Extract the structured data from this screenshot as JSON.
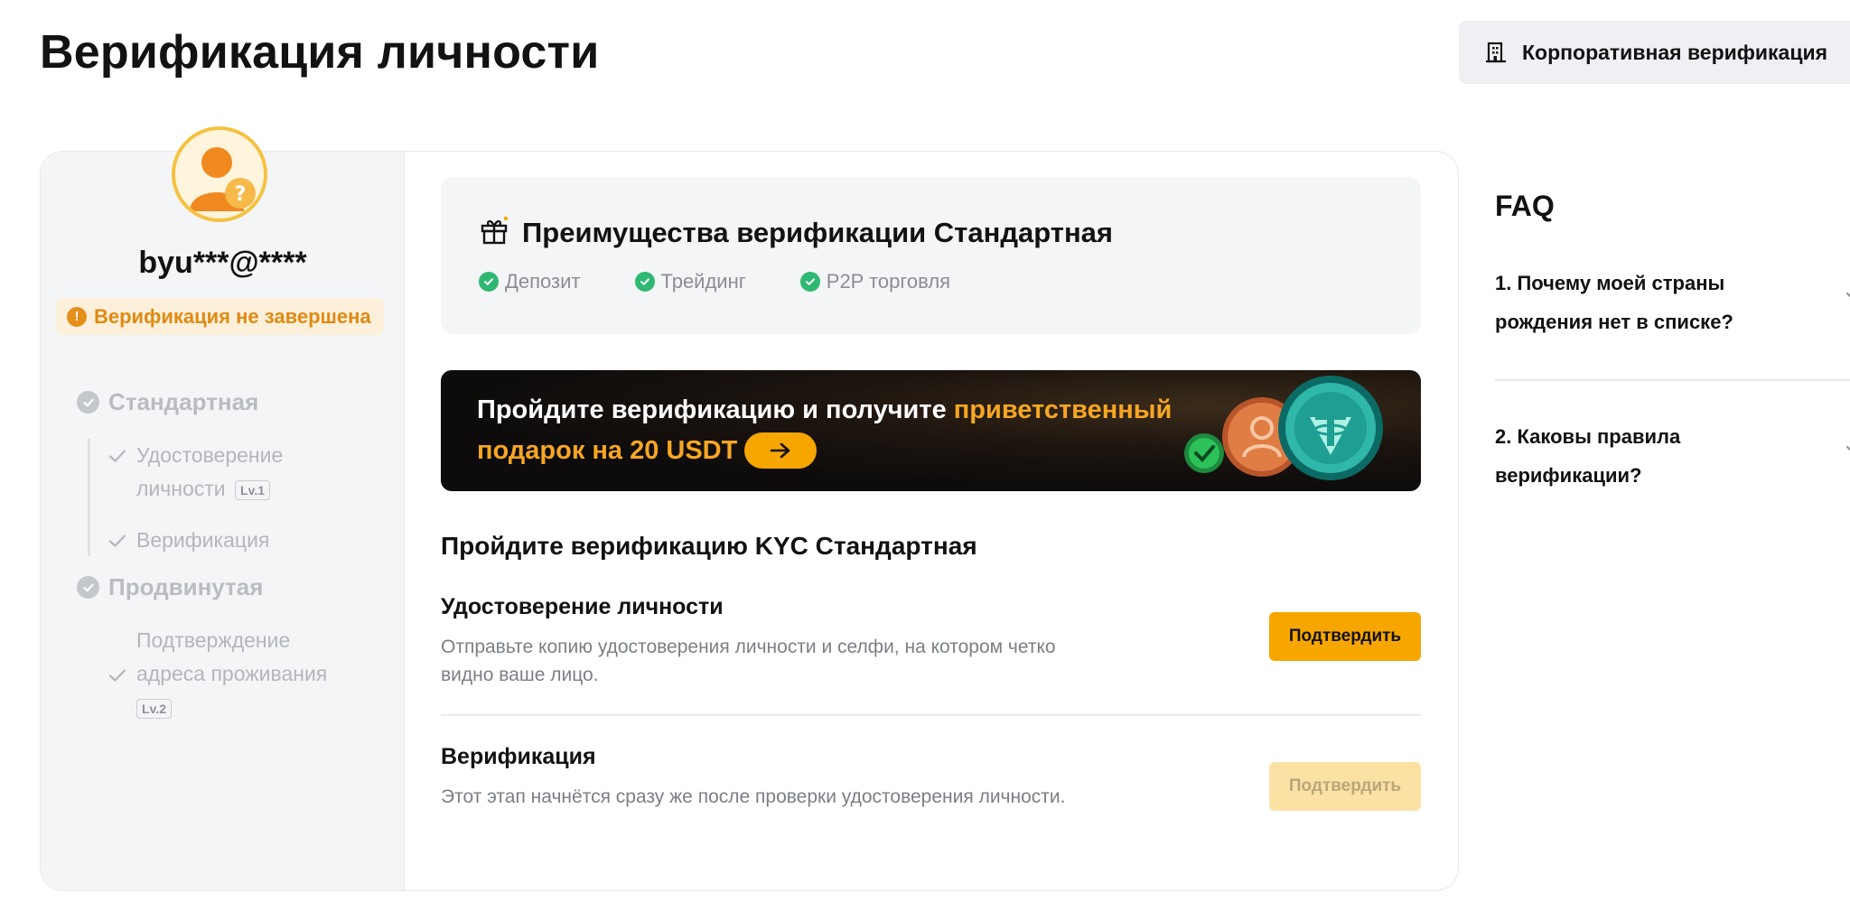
{
  "header": {
    "title": "Верификация личности",
    "corporate_button": "Корпоративная верификация",
    "corporate_icon": "building-icon"
  },
  "sidebar": {
    "username": "byu***@****",
    "status": "Верификация не завершена",
    "levels": [
      {
        "label": "Стандартная",
        "steps": [
          {
            "label_line1": "Удостоверение",
            "label_line2": "личности",
            "badge": "Lv.1"
          },
          {
            "label_line1": "Верификация"
          }
        ]
      },
      {
        "label": "Продвинутая",
        "steps": [
          {
            "label_line1": "Подтверждение",
            "label_line2": "адреса проживания",
            "badge": "Lv.2"
          }
        ]
      }
    ]
  },
  "benefits": {
    "title": "Преимущества верификации Стандартная",
    "items": [
      "Депозит",
      "Трейдинг",
      "P2P торговля"
    ]
  },
  "banner": {
    "text_white": "Пройдите верификацию и получите ",
    "text_highlight": "приветственный",
    "text_line2": "подарок на 20 USDT"
  },
  "kyc": {
    "title": "Пройдите верификацию KYC Стандартная",
    "steps": [
      {
        "name": "Удостоверение личности",
        "desc": "Отправьте копию удостоверения личности и селфи, на котором четко видно ваше лицо.",
        "button": "Подтвердить"
      },
      {
        "name": "Верификация",
        "desc": "Этот этап начнётся сразу же после проверки удостоверения личности.",
        "button": "Подтвердить"
      }
    ]
  },
  "faq": {
    "title": "FAQ",
    "items": [
      "1. Почему моей страны рождения нет в списке?",
      "2. Каковы правила верификации?"
    ]
  },
  "colors": {
    "accent": "#f7a600",
    "warning": "#e08a12",
    "success": "#2eb872"
  }
}
